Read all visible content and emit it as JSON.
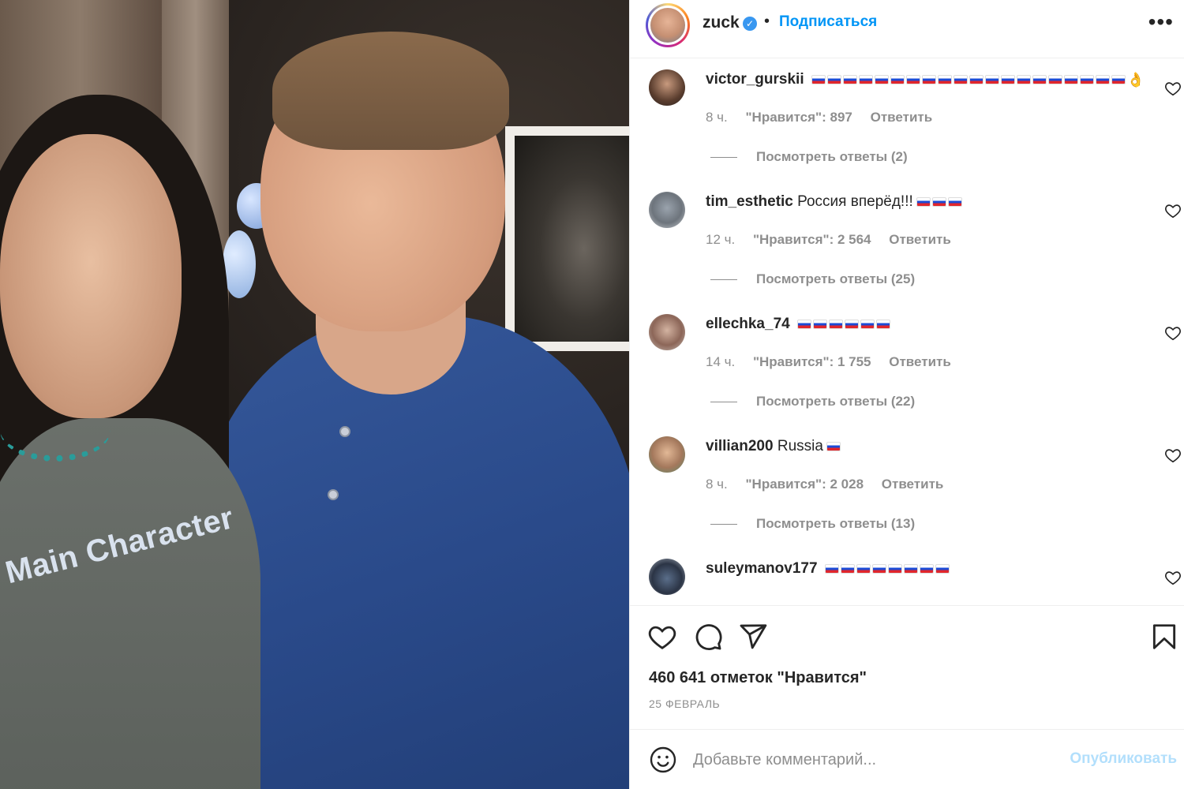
{
  "photo": {
    "shirt_text": "Main Character"
  },
  "header": {
    "username": "zuck",
    "verified": "✓",
    "separator": "•",
    "follow_label": "Подписаться",
    "more_label": "•••"
  },
  "comments": [
    {
      "user": "victor_gurskii",
      "text": "",
      "flags": 20,
      "trailing_emoji": "👌",
      "time": "8 ч.",
      "likes": "\"Нравится\": 897",
      "reply": "Ответить",
      "replies": "Посмотреть ответы (2)"
    },
    {
      "user": "tim_esthetic",
      "text": "Россия вперёд!!!",
      "flags": 3,
      "trailing_emoji": "",
      "time": "12 ч.",
      "likes": "\"Нравится\": 2 564",
      "reply": "Ответить",
      "replies": "Посмотреть ответы (25)"
    },
    {
      "user": "ellechka_74",
      "text": "",
      "flags": 6,
      "trailing_emoji": "",
      "time": "14 ч.",
      "likes": "\"Нравится\": 1 755",
      "reply": "Ответить",
      "replies": "Посмотреть ответы (22)"
    },
    {
      "user": "villian200",
      "text": "Russia",
      "flags": 1,
      "trailing_emoji": "",
      "time": "8 ч.",
      "likes": "\"Нравится\": 2 028",
      "reply": "Ответить",
      "replies": "Посмотреть ответы (13)"
    },
    {
      "user": "suleymanov177",
      "text": "",
      "flags": 8,
      "trailing_emoji": "",
      "time": "",
      "likes": "",
      "reply": "",
      "replies": ""
    }
  ],
  "actions": {
    "icons": [
      "heart-icon",
      "comment-icon",
      "share-icon",
      "bookmark-icon"
    ],
    "likes_count": "460 641 отметок \"Нравится\"",
    "date": "25 ФЕВРАЛЬ"
  },
  "add_comment": {
    "placeholder": "Добавьте комментарий...",
    "publish_label": "Опубликовать"
  },
  "colors": {
    "link_blue": "#0095f6",
    "publish_disabled": "#b2dffc",
    "muted_text": "#8e8e8e"
  }
}
